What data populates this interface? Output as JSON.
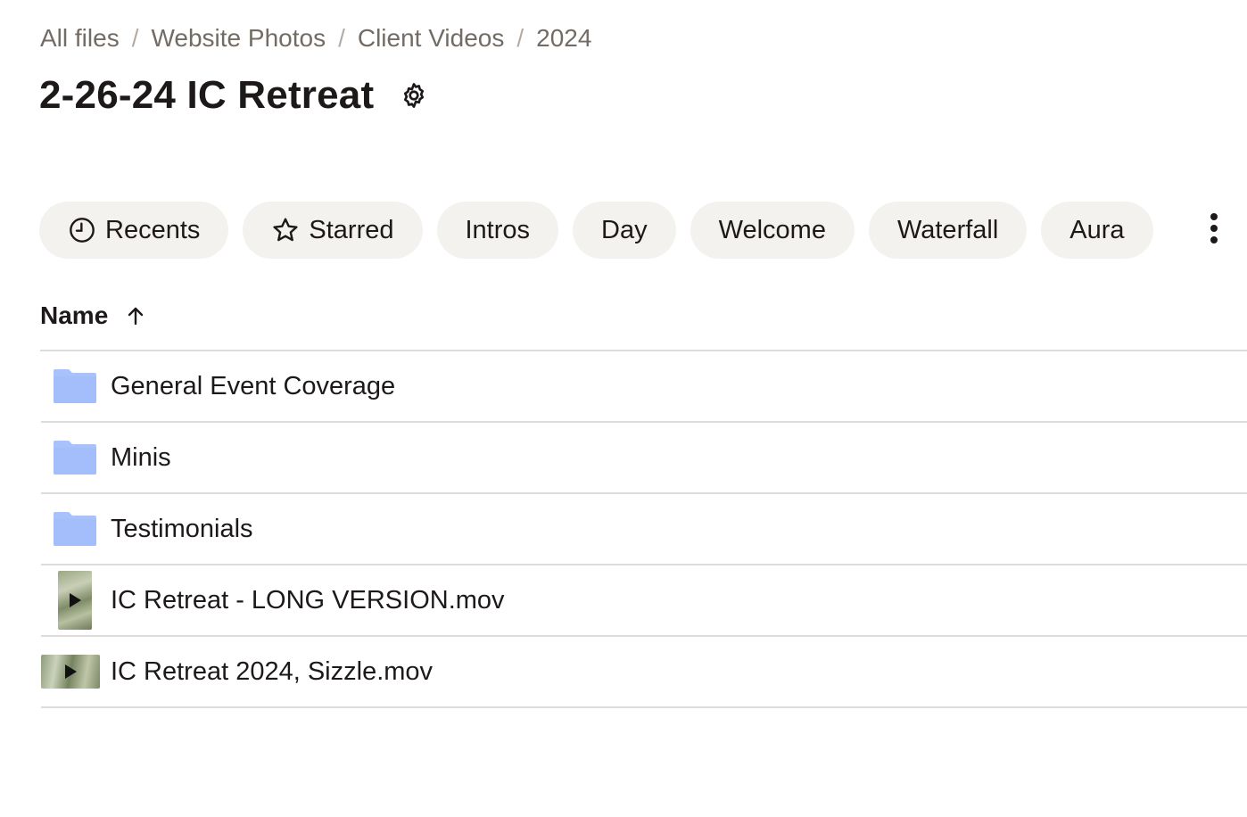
{
  "breadcrumb": {
    "items": [
      "All files",
      "Website Photos",
      "Client Videos",
      "2024"
    ],
    "separator": "/"
  },
  "page": {
    "title": "2-26-24 IC Retreat"
  },
  "chips": [
    {
      "label": "Recents",
      "icon": "clock-icon"
    },
    {
      "label": "Starred",
      "icon": "star-icon"
    },
    {
      "label": "Intros"
    },
    {
      "label": "Day"
    },
    {
      "label": "Welcome"
    },
    {
      "label": "Waterfall"
    },
    {
      "label": "Aura"
    }
  ],
  "table": {
    "column_name": "Name",
    "sort": "ascending",
    "rows": [
      {
        "name": "General Event Coverage",
        "type": "folder",
        "icon": "folder-icon"
      },
      {
        "name": "Minis",
        "type": "folder",
        "icon": "folder-icon"
      },
      {
        "name": "Testimonials",
        "type": "folder",
        "icon": "folder-icon"
      },
      {
        "name": "IC Retreat - LONG VERSION.mov",
        "type": "video",
        "icon": "video-thumbnail-portrait"
      },
      {
        "name": "IC Retreat 2024, Sizzle.mov",
        "type": "video",
        "icon": "video-thumbnail-landscape"
      }
    ]
  },
  "colors": {
    "text": "#1e1919",
    "muted": "#736c64",
    "chip_bg": "#f4f2ef",
    "divider": "#dfdcd8",
    "folder_blue": "#a8c2fb"
  }
}
